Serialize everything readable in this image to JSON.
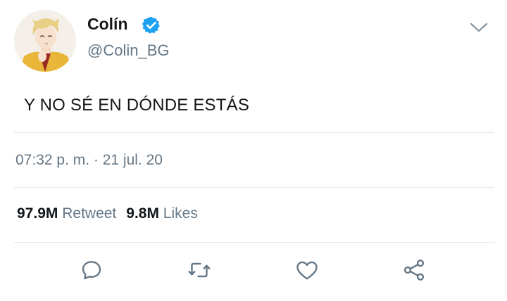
{
  "user": {
    "display_name": "Colín",
    "handle": "@Colin_BG",
    "verified": true,
    "avatar_icon": "avatar-illustration"
  },
  "tweet": {
    "text": "Y NO SÉ EN DÓNDE ESTÁS",
    "timestamp": "07:32 p. m. · 21 jul. 20"
  },
  "stats": {
    "retweets_count": "97.9M",
    "retweets_label": "Retweet",
    "likes_count": "9.8M",
    "likes_label": "Likes"
  },
  "actions": [
    {
      "name": "reply",
      "icon": "reply-icon"
    },
    {
      "name": "retweet",
      "icon": "retweet-icon"
    },
    {
      "name": "like",
      "icon": "heart-icon"
    },
    {
      "name": "share",
      "icon": "share-icon"
    }
  ],
  "colors": {
    "verified": "#1da1f2",
    "text_primary": "#14171a",
    "text_secondary": "#657786",
    "divider": "#e1e8ed"
  }
}
